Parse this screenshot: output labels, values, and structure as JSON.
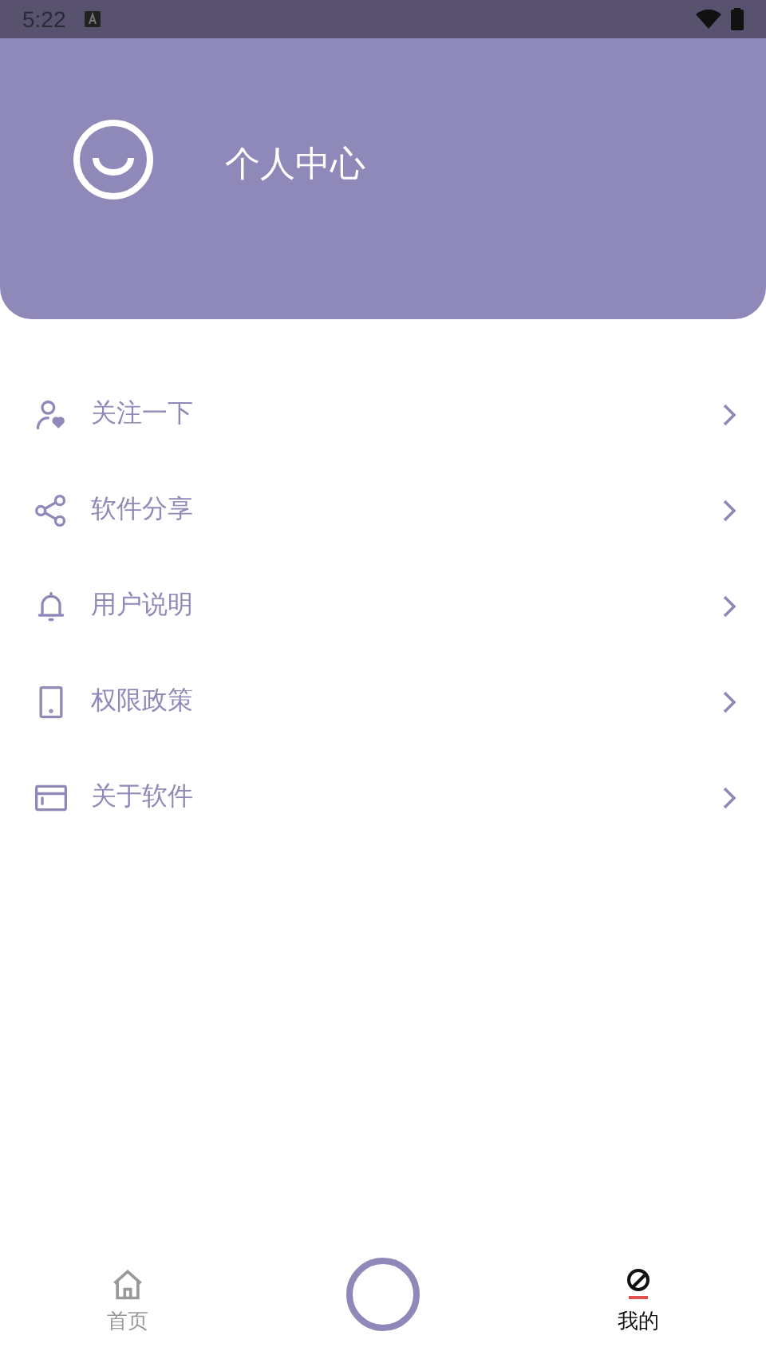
{
  "status_bar": {
    "time": "5:22"
  },
  "header": {
    "title": "个人中心"
  },
  "menu": [
    {
      "label": "关注一下",
      "kind": "follow"
    },
    {
      "label": "软件分享",
      "kind": "share"
    },
    {
      "label": "用户说明",
      "kind": "notice"
    },
    {
      "label": "权限政策",
      "kind": "policy"
    },
    {
      "label": "关于软件",
      "kind": "about"
    }
  ],
  "tabs": [
    {
      "label": "首页",
      "kind": "home",
      "selected": false
    },
    {
      "label": "我的",
      "kind": "mine",
      "selected": true
    }
  ]
}
